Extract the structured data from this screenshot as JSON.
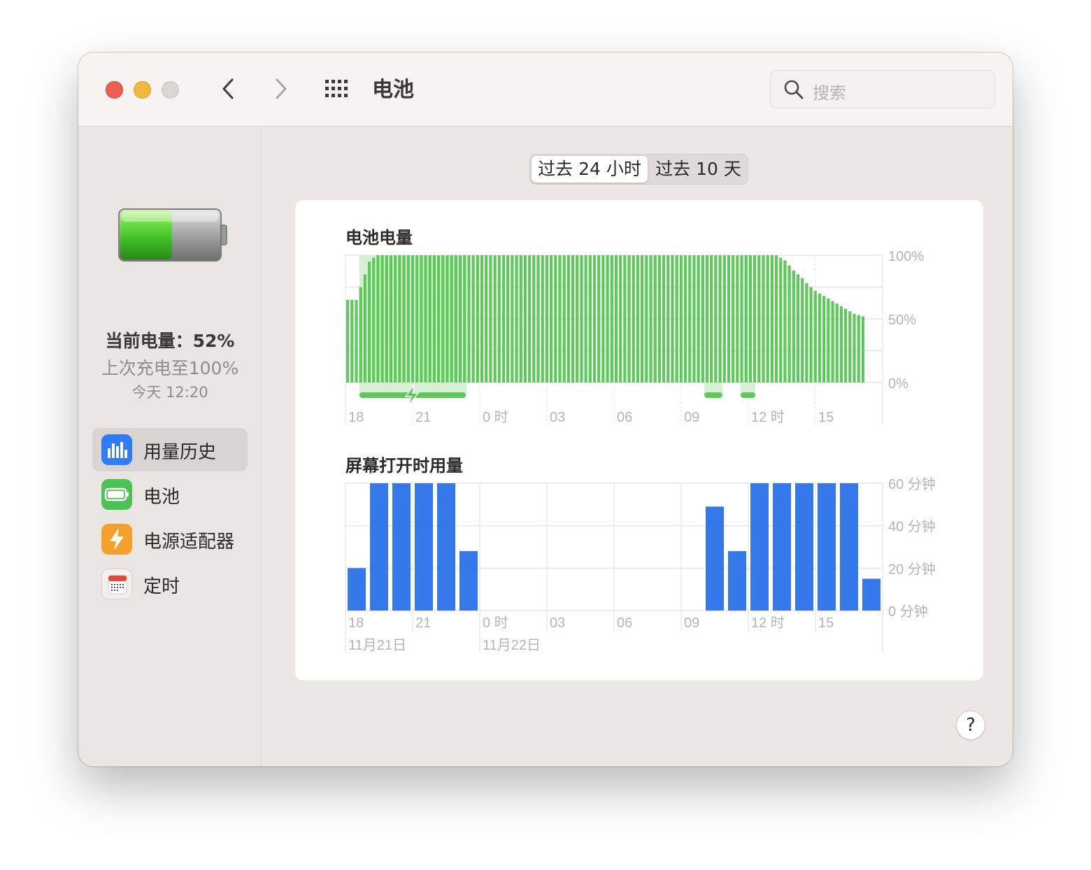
{
  "window": {
    "title": "电池",
    "search_placeholder": "搜索"
  },
  "sidebar": {
    "current_level": "当前电量：52%",
    "last_charged": "上次充电至100%",
    "charge_time": "今天 12:20",
    "battery_fill_fraction": 0.52,
    "items": [
      {
        "label": "用量历史",
        "icon": "usage-history-icon",
        "color": "#2f7af5",
        "active": true
      },
      {
        "label": "电池",
        "icon": "battery-icon",
        "color": "#4cc254",
        "active": false
      },
      {
        "label": "电源适配器",
        "icon": "bolt-icon",
        "color": "#f5a02a",
        "active": false
      },
      {
        "label": "定时",
        "icon": "calendar-icon",
        "color": "#f2f0ef",
        "active": false
      }
    ]
  },
  "segmented": {
    "options": [
      "过去 24 小时",
      "过去 10 天"
    ],
    "selected": 0
  },
  "help_label": "?",
  "chart_data": [
    {
      "type": "bar",
      "title": "电池电量",
      "color": "#5ec85b",
      "charging_color": "#d7efd3",
      "x_ticks": [
        "18",
        "21",
        "0 时",
        "03",
        "06",
        "09",
        "12 时",
        "15"
      ],
      "y_ticks": [
        "100%",
        "50%",
        "0%"
      ],
      "ylim": [
        0,
        100
      ],
      "values": [
        65,
        65,
        65,
        75,
        85,
        95,
        98,
        100,
        100,
        100,
        100,
        100,
        100,
        100,
        100,
        100,
        100,
        100,
        100,
        100,
        100,
        100,
        100,
        100,
        100,
        100,
        100,
        100,
        100,
        100,
        100,
        100,
        100,
        100,
        100,
        100,
        100,
        100,
        100,
        100,
        100,
        100,
        100,
        100,
        100,
        100,
        100,
        100,
        100,
        100,
        100,
        100,
        100,
        100,
        100,
        100,
        100,
        100,
        100,
        100,
        100,
        100,
        100,
        100,
        100,
        100,
        100,
        100,
        100,
        100,
        100,
        100,
        100,
        100,
        100,
        100,
        100,
        100,
        100,
        100,
        100,
        100,
        100,
        100,
        100,
        100,
        100,
        100,
        100,
        100,
        100,
        100,
        100,
        100,
        100,
        100,
        100,
        100,
        100,
        100,
        98,
        96,
        92,
        88,
        85,
        82,
        78,
        75,
        72,
        70,
        68,
        66,
        64,
        62,
        60,
        58,
        56,
        54,
        53,
        52
      ]
    },
    {
      "type": "bar",
      "title": "屏幕打开时用量",
      "color": "#3478ec",
      "x_ticks": [
        "18",
        "21",
        "0 时",
        "03",
        "06",
        "09",
        "12 时",
        "15"
      ],
      "date_labels": [
        "11月21日",
        "11月22日"
      ],
      "y_ticks": [
        "60 分钟",
        "40 分钟",
        "20 分钟",
        "0 分钟"
      ],
      "ylim": [
        0,
        60
      ],
      "values": [
        20,
        60,
        60,
        60,
        60,
        28,
        0,
        0,
        0,
        0,
        0,
        0,
        0,
        0,
        0,
        0,
        49,
        28,
        60,
        60,
        60,
        60,
        60,
        15
      ]
    }
  ]
}
